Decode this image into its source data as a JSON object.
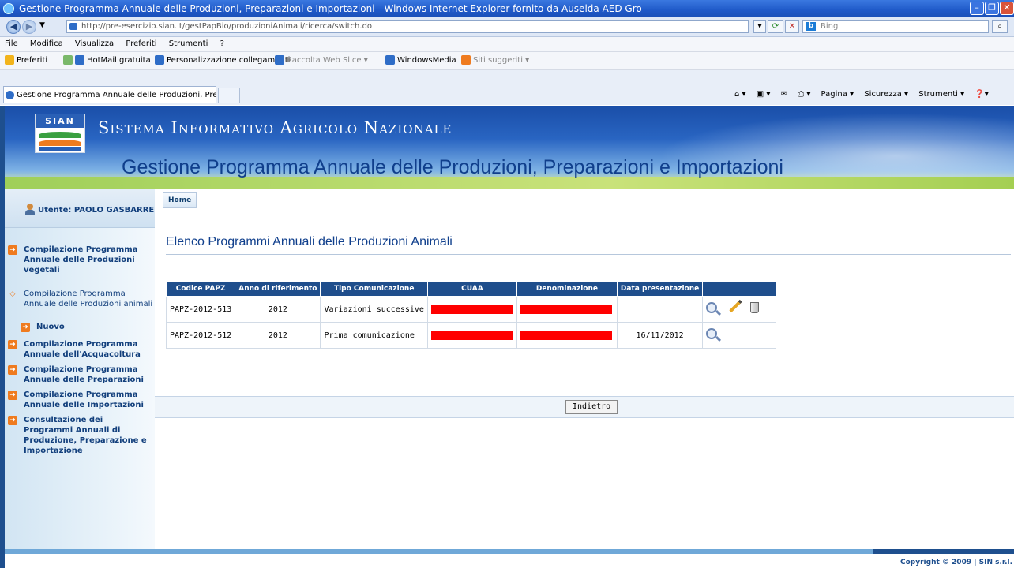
{
  "browser": {
    "title": "Gestione Programma Annuale delle Produzioni, Preparazioni e Importazioni - Windows Internet Explorer fornito da Auselda AED Gro",
    "url": "http://pre-esercizio.sian.it/gestPapBio/produzioniAnimali/ricerca/switch.do",
    "search_placeholder": "Bing",
    "menu": [
      "File",
      "Modifica",
      "Visualizza",
      "Preferiti",
      "Strumenti",
      "?"
    ],
    "favorites_label": "Preferiti",
    "favorites": [
      "HotMail gratuita",
      "Personalizzazione collegamenti",
      "Raccolta Web Slice ▾",
      "WindowsMedia",
      "Siti suggeriti ▾"
    ],
    "tab_label": "Gestione Programma Annuale delle Produzioni, Prepar...",
    "commands": [
      "Pagina ▾",
      "Sicurezza ▾",
      "Strumenti ▾"
    ]
  },
  "header": {
    "logo_text": "SIAN",
    "system_name": "Sistema Informativo Agricolo Nazionale",
    "app_title": "Gestione Programma Annuale delle Produzioni, Preparazioni e Importazioni"
  },
  "sidebar": {
    "user_label": "Utente: PAOLO GASBARRE",
    "items": [
      {
        "label": "Compilazione Programma Annuale delle Produzioni vegetali"
      },
      {
        "label": "Compilazione Programma Annuale delle Produzioni animali"
      },
      {
        "label": "Nuovo"
      },
      {
        "label": "Compilazione Programma Annuale dell'Acquacoltura"
      },
      {
        "label": "Compilazione Programma Annuale delle Preparazioni"
      },
      {
        "label": "Compilazione Programma Annuale delle Importazioni"
      },
      {
        "label": "Consultazione dei Programmi Annuali di Produzione, Preparazione e Importazione"
      }
    ]
  },
  "main": {
    "breadcrumb": "Home",
    "heading": "Elenco Programmi Annuali delle Produzioni Animali",
    "columns": [
      "Codice PAPZ",
      "Anno di riferimento",
      "Tipo Comunicazione",
      "CUAA",
      "Denominazione",
      "Data presentazione",
      ""
    ],
    "rows": [
      {
        "codice": "PAPZ-2012-513",
        "anno": "2012",
        "tipo": "Variazioni successive",
        "data": "",
        "actions": [
          "view-icon",
          "edit-icon",
          "delete-icon"
        ]
      },
      {
        "codice": "PAPZ-2012-512",
        "anno": "2012",
        "tipo": "Prima comunicazione",
        "data": "16/11/2012",
        "actions": [
          "view-icon"
        ]
      }
    ],
    "back_button": "Indietro"
  },
  "footer": {
    "copyright": "Copyright © 2009 | SIN s.r.l."
  }
}
